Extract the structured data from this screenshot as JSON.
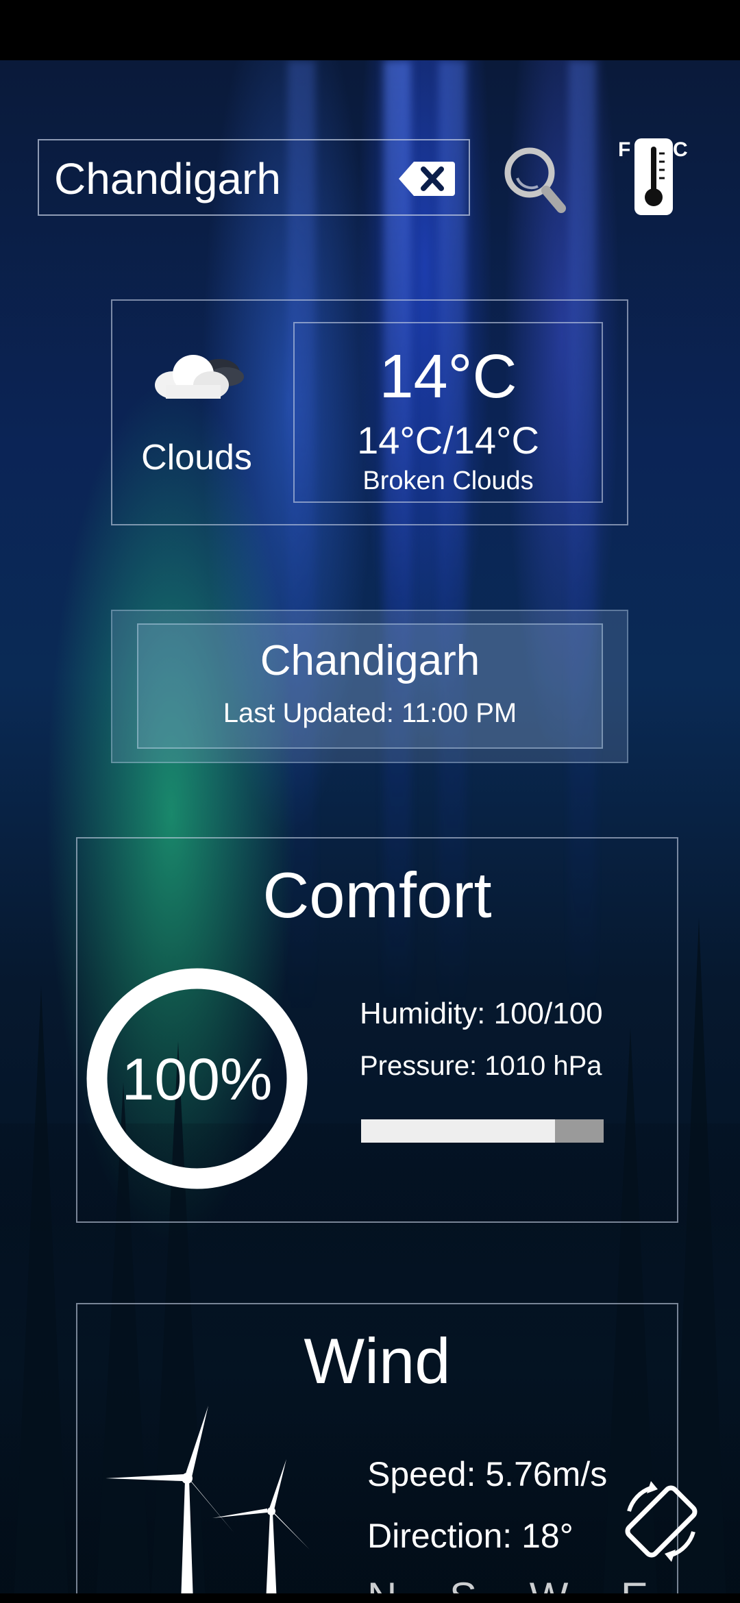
{
  "search": {
    "value": "Chandigarh"
  },
  "unit_toggle": {
    "left": "F",
    "right": "C"
  },
  "current": {
    "condition": "Clouds",
    "temperature": "14°C",
    "range": "14°C/14°C",
    "description": "Broken Clouds"
  },
  "location": {
    "city": "Chandigarh",
    "last_updated": "Last Updated: 11:00 PM"
  },
  "comfort": {
    "title": "Comfort",
    "percent_label": "100%",
    "percent_value": 100,
    "humidity": "Humidity: 100/100",
    "pressure": "Pressure: 1010 hPa",
    "bar_fill_fraction": 0.8
  },
  "wind": {
    "title": "Wind",
    "speed": "Speed: 5.76m/s",
    "direction": "Direction: 18°",
    "compass": "N S W E"
  },
  "icons": {
    "clear": "clear-icon",
    "search": "search-icon",
    "unit": "thermometer-icon",
    "weather": "cloud-icon",
    "wind": "wind-turbine-icon",
    "rotate": "screen-rotate-icon"
  }
}
